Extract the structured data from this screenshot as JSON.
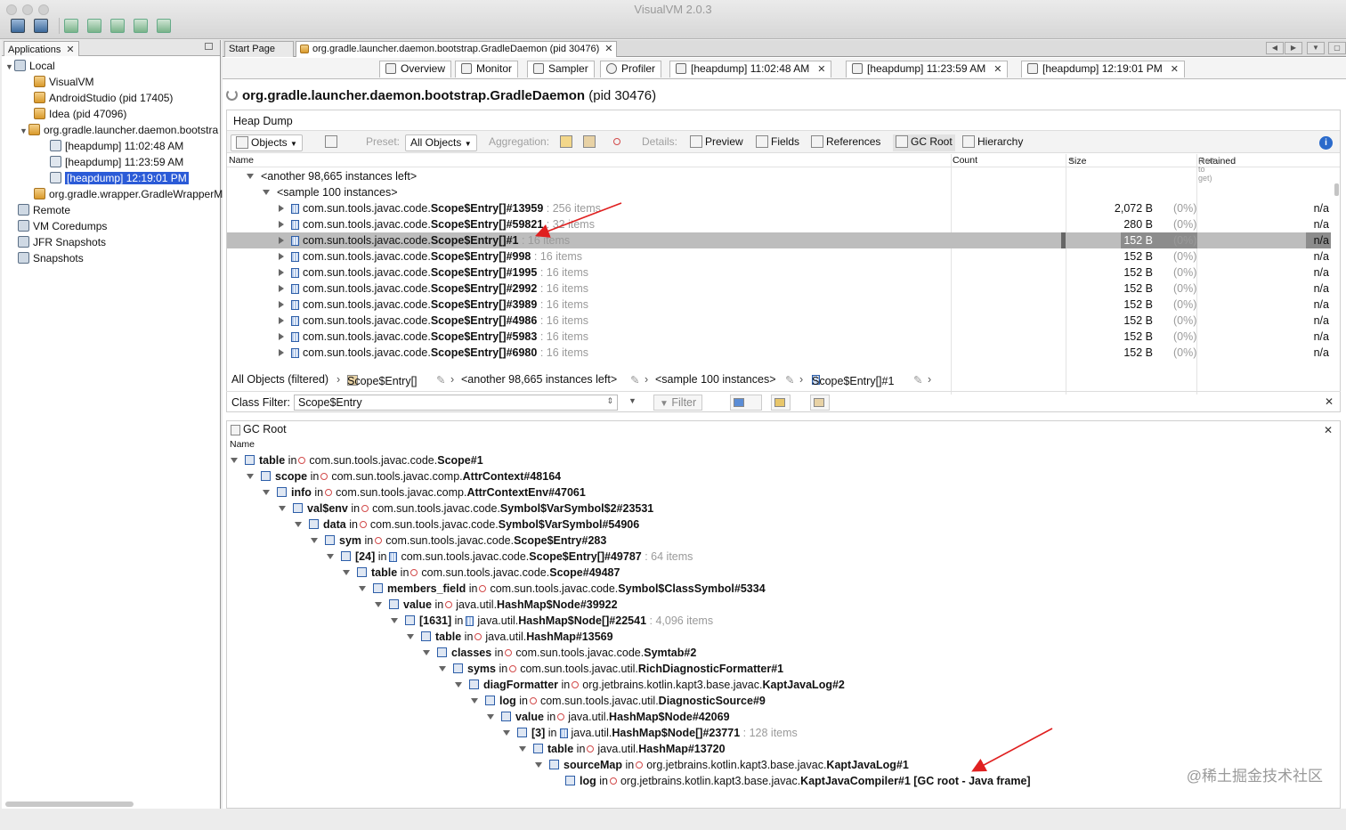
{
  "window": {
    "title": "VisualVM 2.0.3"
  },
  "left": {
    "tab_label": "Applications",
    "tree": [
      {
        "label": "Local"
      },
      {
        "label": "VisualVM"
      },
      {
        "label": "AndroidStudio (pid 17405)"
      },
      {
        "label": "Idea (pid 47096)"
      },
      {
        "label": "org.gradle.launcher.daemon.bootstra"
      },
      {
        "label": "[heapdump] 11:02:48 AM"
      },
      {
        "label": "[heapdump] 11:23:59 AM"
      },
      {
        "label": "[heapdump] 12:19:01 PM"
      },
      {
        "label": "org.gradle.wrapper.GradleWrapperM"
      },
      {
        "label": "Remote"
      },
      {
        "label": "VM Coredumps"
      },
      {
        "label": "JFR Snapshots"
      },
      {
        "label": "Snapshots"
      }
    ]
  },
  "doc_tabs": [
    {
      "label": "Start Page"
    },
    {
      "label": "org.gradle.launcher.daemon.bootstrap.GradleDaemon (pid 30476)"
    }
  ],
  "sub_tabs": [
    {
      "label": "Overview"
    },
    {
      "label": "Monitor"
    },
    {
      "label": "Sampler"
    },
    {
      "label": "Profiler"
    },
    {
      "label": "[heapdump] 11:02:48 AM"
    },
    {
      "label": "[heapdump] 11:23:59 AM"
    },
    {
      "label": "[heapdump] 12:19:01 PM"
    }
  ],
  "page_title": "org.gradle.launcher.daemon.bootstrap.GradleDaemon",
  "page_pid": "(pid 30476)",
  "heap": {
    "title": "Heap Dump",
    "toolbar": {
      "objects": "Objects",
      "preset_label": "Preset:",
      "preset_value": "All Objects",
      "aggregation_label": "Aggregation:",
      "details_label": "Details:",
      "preview": "Preview",
      "fields": "Fields",
      "references": "References",
      "gcroot": "GC Root",
      "hierarchy": "Hierarchy"
    },
    "columns": {
      "name": "Name",
      "count": "Count",
      "size": "Size",
      "retained": "Retained",
      "retained_hint": "(sort to get)"
    },
    "group_row": "<another 98,665 instances left>",
    "sample_row": "<sample 100 instances>",
    "rows": [
      {
        "pre": "com.sun.tools.javac.code.",
        "cls": "Scope$Entry[]#13959",
        "items": ": 256 items",
        "size": "2,072 B",
        "pct": "(0%)",
        "ret": "n/a"
      },
      {
        "pre": "com.sun.tools.javac.code.",
        "cls": "Scope$Entry[]#59821",
        "items": ": 32 items",
        "size": "280 B",
        "pct": "(0%)",
        "ret": "n/a"
      },
      {
        "pre": "com.sun.tools.javac.code.",
        "cls": "Scope$Entry[]#1",
        "items": ": 16 items",
        "size": "152 B",
        "pct": "(0%)",
        "ret": "n/a"
      },
      {
        "pre": "com.sun.tools.javac.code.",
        "cls": "Scope$Entry[]#998",
        "items": ": 16 items",
        "size": "152 B",
        "pct": "(0%)",
        "ret": "n/a"
      },
      {
        "pre": "com.sun.tools.javac.code.",
        "cls": "Scope$Entry[]#1995",
        "items": ": 16 items",
        "size": "152 B",
        "pct": "(0%)",
        "ret": "n/a"
      },
      {
        "pre": "com.sun.tools.javac.code.",
        "cls": "Scope$Entry[]#2992",
        "items": ": 16 items",
        "size": "152 B",
        "pct": "(0%)",
        "ret": "n/a"
      },
      {
        "pre": "com.sun.tools.javac.code.",
        "cls": "Scope$Entry[]#3989",
        "items": ": 16 items",
        "size": "152 B",
        "pct": "(0%)",
        "ret": "n/a"
      },
      {
        "pre": "com.sun.tools.javac.code.",
        "cls": "Scope$Entry[]#4986",
        "items": ": 16 items",
        "size": "152 B",
        "pct": "(0%)",
        "ret": "n/a"
      },
      {
        "pre": "com.sun.tools.javac.code.",
        "cls": "Scope$Entry[]#5983",
        "items": ": 16 items",
        "size": "152 B",
        "pct": "(0%)",
        "ret": "n/a"
      },
      {
        "pre": "com.sun.tools.javac.code.",
        "cls": "Scope$Entry[]#6980",
        "items": ": 16 items",
        "size": "152 B",
        "pct": "(0%)",
        "ret": "n/a"
      }
    ]
  },
  "breadcrumb": [
    "All Objects (filtered)",
    "Scope$Entry[]",
    "<another 98,665 instances left>",
    "<sample 100 instances>",
    "Scope$Entry[]#1"
  ],
  "filter": {
    "label": "Class Filter:",
    "value": "Scope$Entry",
    "button": "Filter"
  },
  "gc": {
    "title": "GC Root",
    "name_col": "Name",
    "rows": [
      {
        "field": "table",
        "pre": "com.sun.tools.javac.code.",
        "cls": "Scope#1",
        "items": ""
      },
      {
        "field": "scope",
        "pre": "com.sun.tools.javac.comp.",
        "cls": "AttrContext#48164",
        "items": ""
      },
      {
        "field": "info",
        "pre": "com.sun.tools.javac.comp.",
        "cls": "AttrContextEnv#47061",
        "items": ""
      },
      {
        "field": "val$env",
        "pre": "com.sun.tools.javac.code.",
        "cls": "Symbol$2#23531",
        "items": "",
        "pre2": "Symbol$VarSymbol$2#23531"
      },
      {
        "field": "data",
        "pre": "com.sun.tools.javac.code.",
        "cls": "Symbol$VarSymbol#54906",
        "items": ""
      },
      {
        "field": "sym",
        "pre": "com.sun.tools.javac.code.",
        "cls": "Scope$Entry#283",
        "items": ""
      },
      {
        "field": "[24]",
        "pre": "com.sun.tools.javac.code.",
        "cls": "Scope$Entry[]#49787",
        "items": ": 64 items",
        "arr": true
      },
      {
        "field": "table",
        "pre": "com.sun.tools.javac.code.",
        "cls": "Scope#49487",
        "items": ""
      },
      {
        "field": "members_field",
        "pre": "com.sun.tools.javac.code.",
        "cls": "Symbol$ClassSymbol#5334",
        "items": ""
      },
      {
        "field": "value",
        "pre": "java.util.",
        "cls": "HashMap$Node#39922",
        "items": ""
      },
      {
        "field": "[1631]",
        "pre": "java.util.",
        "cls": "HashMap$Node[]#22541",
        "items": ": 4,096 items",
        "arr": true
      },
      {
        "field": "table",
        "pre": "java.util.",
        "cls": "HashMap#13569",
        "items": ""
      },
      {
        "field": "classes",
        "pre": "com.sun.tools.javac.code.",
        "cls": "Symtab#2",
        "items": ""
      },
      {
        "field": "syms",
        "pre": "com.sun.tools.javac.util.",
        "cls": "RichDiagnosticFormatter#1",
        "items": ""
      },
      {
        "field": "diagFormatter",
        "pre": "org.jetbrains.kotlin.kapt3.base.javac.",
        "cls": "KaptJavaLog#2",
        "items": ""
      },
      {
        "field": "log",
        "pre": "com.sun.tools.javac.util.",
        "cls": "DiagnosticSource#9",
        "items": ""
      },
      {
        "field": "value",
        "pre": "java.util.",
        "cls": "HashMap$Node#42069",
        "items": ""
      },
      {
        "field": "[3]",
        "pre": "java.util.",
        "cls": "HashMap$Node[]#23771",
        "items": ": 128 items",
        "arr": true
      },
      {
        "field": "table",
        "pre": "java.util.",
        "cls": "HashMap#13720",
        "items": ""
      },
      {
        "field": "sourceMap",
        "pre": "org.jetbrains.kotlin.kapt3.base.javac.",
        "cls": "KaptJavaLog#1",
        "items": ""
      },
      {
        "field": "log",
        "pre": "org.jetbrains.kotlin.kapt3.base.javac.",
        "cls": "KaptJavaCompiler#1 [GC root - Java frame]",
        "items": ""
      }
    ],
    "in_word": "in"
  },
  "watermark": "@稀土掘金技术社区",
  "colors": {
    "selection": "#2b5bd7",
    "highlight_row": "#bdbdbd",
    "annotation_arrow": "#e02020"
  }
}
